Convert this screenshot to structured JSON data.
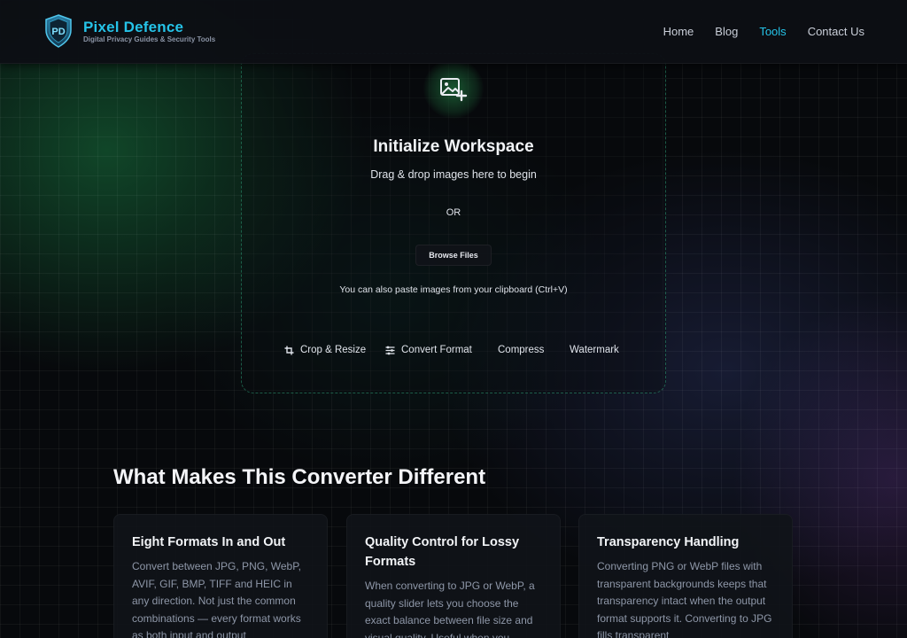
{
  "brand": {
    "name": "Pixel Defence",
    "tagline": "Digital Privacy Guides & Security Tools",
    "logo_icon": "shield-logo-icon",
    "accent_color": "#25c3e8"
  },
  "nav": {
    "items": [
      {
        "label": "Home",
        "active": false
      },
      {
        "label": "Blog",
        "active": false
      },
      {
        "label": "Tools",
        "active": true
      },
      {
        "label": "Contact Us",
        "active": false
      }
    ]
  },
  "workspace": {
    "icon": "image-add-icon",
    "title": "Initialize Workspace",
    "subtitle": "Drag & drop images here to begin",
    "or_text": "OR",
    "browse_label": "Browse Files",
    "paste_hint": "You can also paste images from your clipboard (Ctrl+V)",
    "tools": [
      {
        "label": "Crop & Resize",
        "icon": "crop-icon"
      },
      {
        "label": "Convert Format",
        "icon": "sliders-icon"
      },
      {
        "label": "Compress",
        "icon": ""
      },
      {
        "label": "Watermark",
        "icon": ""
      }
    ]
  },
  "features": {
    "title": "What Makes This Converter Different",
    "cards": [
      {
        "title": "Eight Formats In and Out",
        "description": "Convert between JPG, PNG, WebP, AVIF, GIF, BMP, TIFF and HEIC in any direction. Not just the common combinations — every format works as both input and output"
      },
      {
        "title": "Quality Control for Lossy Formats",
        "description": "When converting to JPG or WebP, a quality slider lets you choose the exact balance between file size and visual quality. Useful when you"
      },
      {
        "title": "Transparency Handling",
        "description": "Converting PNG or WebP files with transparent backgrounds keeps that transparency intact when the output format supports it. Converting to JPG fills transparent"
      }
    ]
  }
}
